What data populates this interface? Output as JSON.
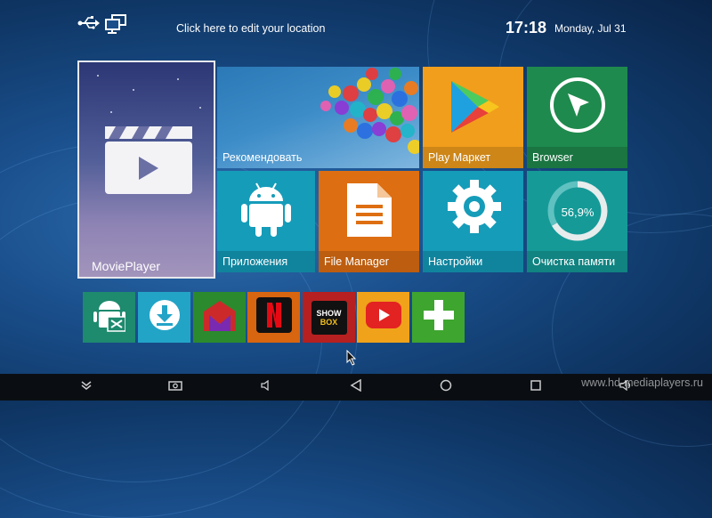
{
  "topbar": {
    "location": "Click here to edit your location",
    "time": "17:18",
    "date": "Monday, Jul 31"
  },
  "tiles": {
    "movieplayer": "MoviePlayer",
    "recommend": "Рекомендовать",
    "playmarket": "Play Маркет",
    "browser": "Browser",
    "apps": "Приложения",
    "filemgr": "File Manager",
    "settings": "Настройки",
    "cleaner": "Очистка памяти",
    "cleaner_percent": "56,9%"
  },
  "shortcuts": {
    "showbox_line1": "SHOW",
    "showbox_line2": "BOX"
  },
  "watermark": "www.hd-mediaplayers.ru",
  "colors": {
    "playmarket": "#f19e1c",
    "browser": "#1f8a4d",
    "apps": "#159cb9",
    "filemgr": "#de6e12",
    "cleaner": "#159a98"
  },
  "icons": {
    "topbar": [
      "usb-icon",
      "network-icon"
    ],
    "navbar": [
      "hide-bar-icon",
      "screenshot-icon",
      "volume-down-icon",
      "back-icon",
      "home-icon",
      "recents-icon",
      "volume-up-icon"
    ],
    "shortcuts": [
      "android-tools-icon",
      "downloader-icon",
      "mobdro-icon",
      "netflix-icon",
      "showbox-icon",
      "youtube-icon",
      "add-icon"
    ]
  }
}
